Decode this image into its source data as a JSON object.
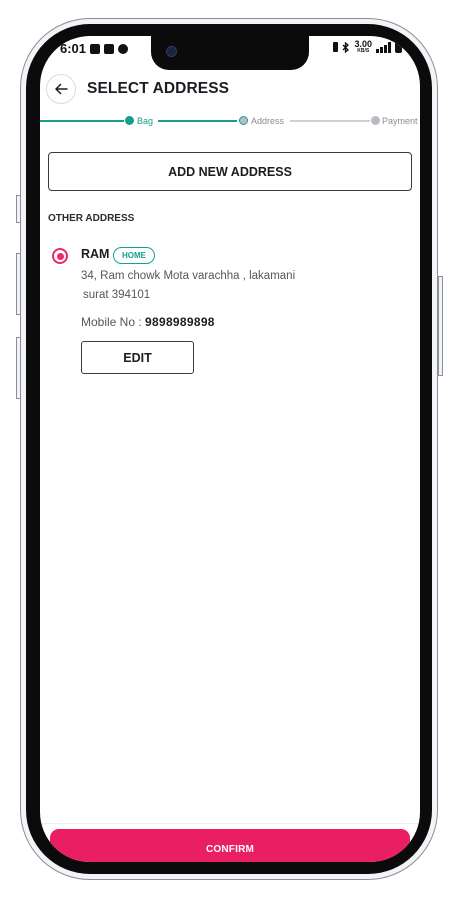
{
  "statusbar": {
    "time": "6:01",
    "speed_value": "3.00",
    "speed_unit": "KB/S"
  },
  "header": {
    "title": "SELECT ADDRESS"
  },
  "stepper": {
    "steps": [
      {
        "label": "Bag",
        "state": "done"
      },
      {
        "label": "Address",
        "state": "current"
      },
      {
        "label": "Payment",
        "state": "pending"
      }
    ]
  },
  "add_address_label": "ADD NEW ADDRESS",
  "section_label": "OTHER ADDRESS",
  "address": {
    "name": "RAM",
    "tag": "HOME",
    "line1": "34, Ram chowk Mota varachha , lakamani",
    "line2": "surat 394101",
    "mobile_label": "Mobile No : ",
    "mobile_value": "9898989898",
    "selected": true
  },
  "edit_label": "EDIT",
  "confirm_label": "CONFIRM",
  "colors": {
    "accent": "#ea1f63",
    "teal": "#14a08c",
    "text": "#1c1d22"
  }
}
